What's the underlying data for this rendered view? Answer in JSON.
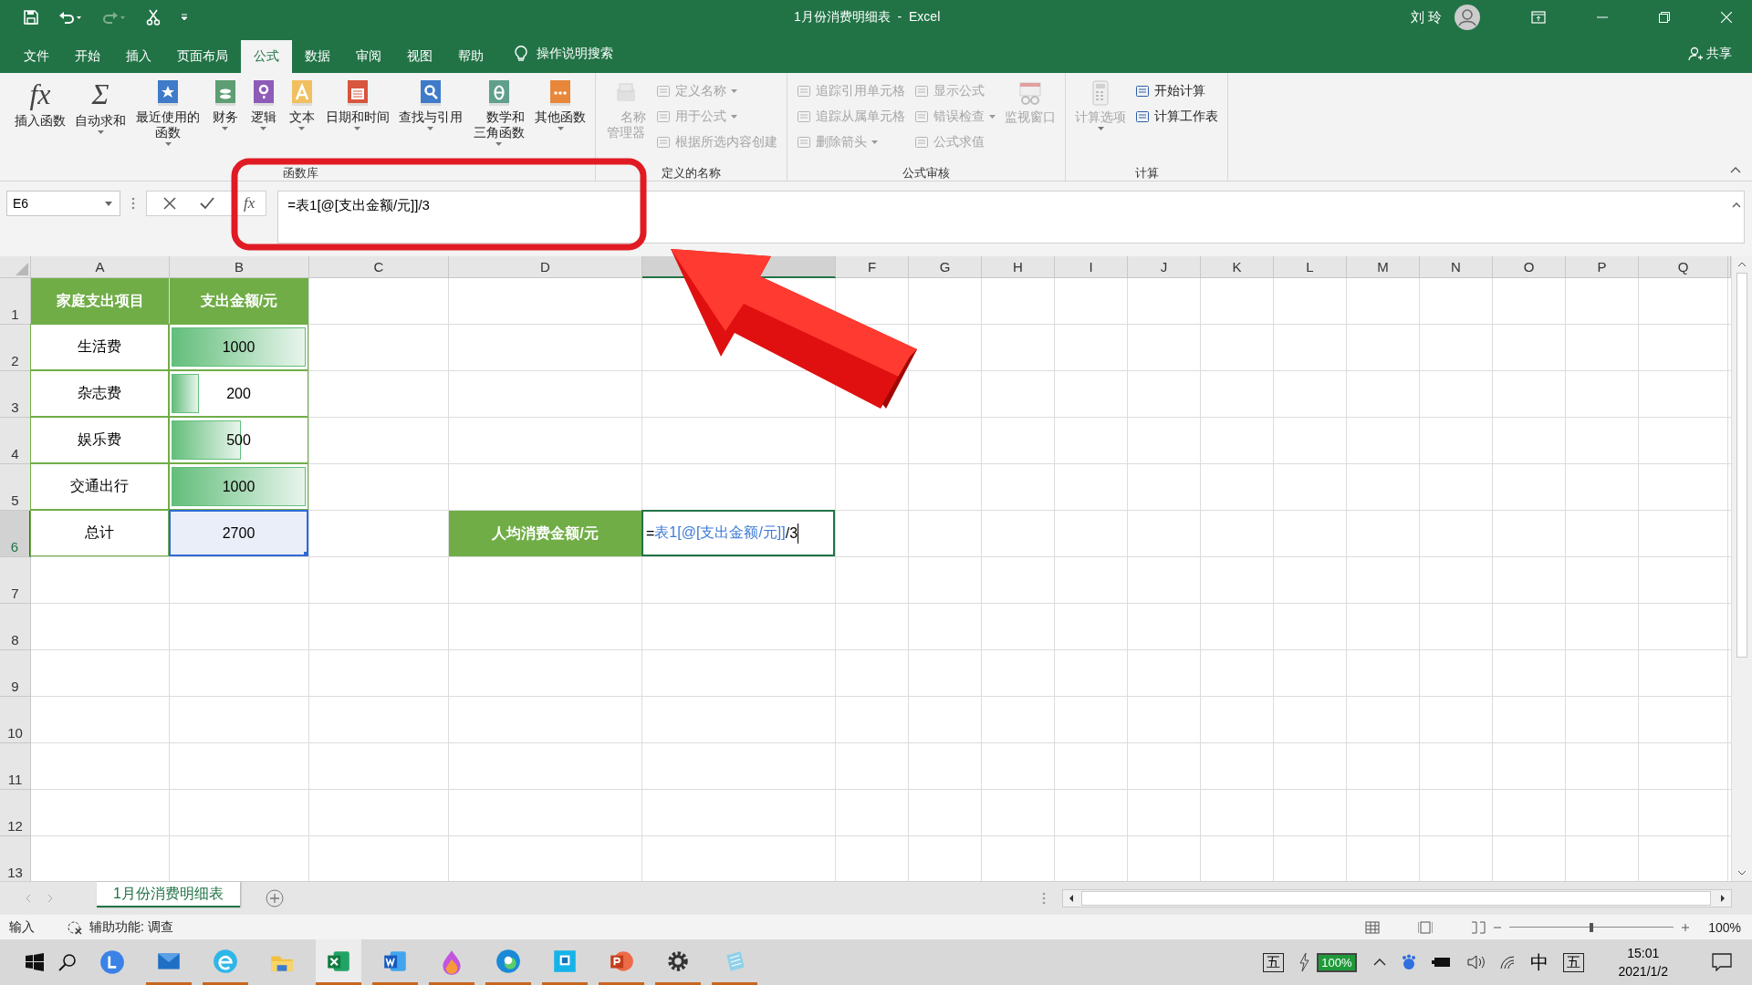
{
  "window": {
    "title": "1月份消费明细表  -  Excel",
    "user": "刘 玲"
  },
  "tabs": [
    {
      "label": "文件",
      "selected": false
    },
    {
      "label": "开始",
      "selected": false
    },
    {
      "label": "插入",
      "selected": false
    },
    {
      "label": "页面布局",
      "selected": false
    },
    {
      "label": "公式",
      "selected": true
    },
    {
      "label": "数据",
      "selected": false
    },
    {
      "label": "审阅",
      "selected": false
    },
    {
      "label": "视图",
      "selected": false
    },
    {
      "label": "帮助",
      "selected": false
    }
  ],
  "tell_me": "操作说明搜索",
  "share": "共享",
  "ribbon": {
    "groups": [
      {
        "title": "函数库",
        "items": [
          {
            "kind": "glyph",
            "glyph": "fx",
            "label": "插入函数",
            "dropdown": false,
            "disabled": false
          },
          {
            "kind": "glyph",
            "glyph": "Σ",
            "label": "自动求和",
            "dropdown": true,
            "disabled": false
          },
          {
            "kind": "book",
            "color": "#3f7bc8",
            "label": "最近使用的函数",
            "dropdown": true,
            "disabled": false
          },
          {
            "kind": "book",
            "color": "#5d9e73",
            "label": "财务",
            "dropdown": true,
            "disabled": false
          },
          {
            "kind": "book",
            "color": "#8e5bb8",
            "label": "逻辑",
            "dropdown": true,
            "disabled": false
          },
          {
            "kind": "book",
            "color": "#f0c060",
            "label": "文本",
            "dropdown": true,
            "disabled": false
          },
          {
            "kind": "book",
            "color": "#d8553e",
            "label": "日期和时间",
            "dropdown": true,
            "disabled": false
          },
          {
            "kind": "book",
            "color": "#3f7bc8",
            "label": "查找与引用",
            "dropdown": true,
            "disabled": false
          },
          {
            "kind": "book",
            "color": "#5f9f8c",
            "label": "数学和三角函数",
            "dropdown": true,
            "disabled": false
          },
          {
            "kind": "book",
            "color": "#e8873a",
            "label": "其他函数",
            "dropdown": true,
            "disabled": false
          }
        ]
      },
      {
        "title": "定义的名称",
        "items": [
          {
            "kind": "tool",
            "label": "名称管理器",
            "dropdown": false,
            "disabled": true
          },
          {
            "kind": "stack",
            "items": [
              {
                "label": "定义名称",
                "dropdown": true,
                "disabled": true
              },
              {
                "label": "用于公式",
                "dropdown": true,
                "disabled": true
              },
              {
                "label": "根据所选内容创建",
                "dropdown": false,
                "disabled": true
              }
            ]
          }
        ]
      },
      {
        "title": "公式审核",
        "items": [
          {
            "kind": "stack",
            "items": [
              {
                "label": "追踪引用单元格",
                "dropdown": false,
                "disabled": true
              },
              {
                "label": "追踪从属单元格",
                "dropdown": false,
                "disabled": true
              },
              {
                "label": "删除箭头",
                "dropdown": true,
                "disabled": true
              }
            ]
          },
          {
            "kind": "stack",
            "items": [
              {
                "label": "显示公式",
                "dropdown": false,
                "disabled": true
              },
              {
                "label": "错误检查",
                "dropdown": true,
                "disabled": true
              },
              {
                "label": "公式求值",
                "dropdown": false,
                "disabled": true
              }
            ]
          },
          {
            "kind": "tool",
            "label": "监视窗口",
            "dropdown": false,
            "disabled": true
          }
        ]
      },
      {
        "title": "计算",
        "items": [
          {
            "kind": "tool",
            "label": "计算选项",
            "dropdown": true,
            "disabled": true
          },
          {
            "kind": "stack",
            "items": [
              {
                "label": "开始计算",
                "dropdown": false,
                "disabled": false
              },
              {
                "label": "计算工作表",
                "dropdown": false,
                "disabled": false
              }
            ]
          }
        ]
      }
    ]
  },
  "formula_bar": {
    "name_box": "E6",
    "fx_button": "fx",
    "formula": "=表1[@[支出金额/元]]/3"
  },
  "sheet": {
    "columns": [
      {
        "label": "A",
        "selected": false
      },
      {
        "label": "B",
        "selected": false
      },
      {
        "label": "C",
        "selected": false
      },
      {
        "label": "D",
        "selected": false
      },
      {
        "selected": true
      },
      {
        "label": "F",
        "selected": false
      },
      {
        "label": "G",
        "selected": false
      },
      {
        "label": "H",
        "selected": false
      },
      {
        "label": "I",
        "selected": false
      },
      {
        "label": "J",
        "selected": false
      },
      {
        "label": "K",
        "selected": false
      },
      {
        "label": "L",
        "selected": false
      },
      {
        "label": "M",
        "selected": false
      },
      {
        "label": "N",
        "selected": false
      },
      {
        "label": "O",
        "selected": false
      },
      {
        "label": "P",
        "selected": false
      },
      {
        "label": "Q",
        "selected": false
      }
    ],
    "rows": [
      {
        "number": "1",
        "selected": false,
        "cells": [
          {
            "kind": "header",
            "text": "家庭支出项目"
          },
          {
            "kind": "header",
            "text": "支出金额/元"
          }
        ]
      },
      {
        "number": "2",
        "selected": false,
        "cells": [
          {
            "kind": "text",
            "text": "生活费"
          },
          {
            "kind": "databar",
            "text": "1000",
            "level": 1
          }
        ]
      },
      {
        "number": "3",
        "selected": false,
        "cells": [
          {
            "kind": "text",
            "text": "杂志费"
          },
          {
            "kind": "databar",
            "text": "200",
            "level": 0.2
          }
        ]
      },
      {
        "number": "4",
        "selected": false,
        "cells": [
          {
            "kind": "text",
            "text": "娱乐费"
          },
          {
            "kind": "databar",
            "text": "500",
            "level": 0.5
          }
        ]
      },
      {
        "number": "5",
        "selected": false,
        "cells": [
          {
            "kind": "text",
            "text": "交通出行"
          },
          {
            "kind": "databar",
            "text": "1000",
            "level": 1
          }
        ]
      },
      {
        "number": "6",
        "selected": true,
        "cells": [
          {
            "kind": "text",
            "text": "总计"
          },
          {
            "kind": "referenced",
            "text": "2700"
          },
          {
            "kind": "empty"
          },
          {
            "kind": "header",
            "text": "人均消费金额/元"
          },
          {
            "kind": "editing",
            "parts": [
              {
                "kind": "plain",
                "text": "="
              },
              {
                "kind": "ref",
                "text": "表1[@[支出金额/元]]"
              },
              {
                "kind": "plain",
                "text": "/3"
              }
            ]
          }
        ]
      },
      {
        "number": "7",
        "selected": false
      },
      {
        "number": "8",
        "selected": false
      },
      {
        "number": "9",
        "selected": false
      },
      {
        "number": "10",
        "selected": false
      },
      {
        "number": "11",
        "selected": false
      },
      {
        "number": "12",
        "selected": false
      },
      {
        "number": "13",
        "selected": false
      }
    ]
  },
  "sheet_tabs": [
    {
      "label": "1月份消费明细表",
      "selected": true
    }
  ],
  "status_bar": {
    "mode": "输入",
    "accessibility": "辅助功能: 调查",
    "zoom_slider": {
      "level": 0.5
    },
    "zoom": "100%"
  },
  "taskbar": {
    "apps": [
      {
        "kind": "launcher",
        "running": false,
        "selected": false
      },
      {
        "kind": "mail",
        "running": true,
        "selected": false
      },
      {
        "kind": "browser",
        "running": true,
        "selected": false
      },
      {
        "kind": "folder",
        "running": false,
        "selected": false
      },
      {
        "kind": "excel",
        "running": true,
        "selected": true
      },
      {
        "kind": "word",
        "running": true,
        "selected": false
      },
      {
        "kind": "paint",
        "running": true,
        "selected": false
      },
      {
        "kind": "edge",
        "running": true,
        "selected": false
      },
      {
        "kind": "screen",
        "running": true,
        "selected": false
      },
      {
        "kind": "powerpoint",
        "running": true,
        "selected": false
      },
      {
        "kind": "settings",
        "running": true,
        "selected": false
      },
      {
        "kind": "notepad",
        "running": true,
        "selected": false
      }
    ]
  },
  "tray": {
    "ime_left": "五",
    "battery": "100%",
    "language": "中",
    "ime_right": "五",
    "time": "15:01",
    "date": "2021/1/2"
  }
}
